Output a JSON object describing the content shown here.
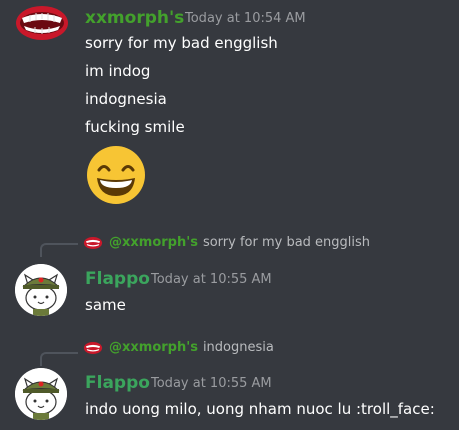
{
  "messages": [
    {
      "author": "xxmorph's",
      "timestamp": "Today at 10:54 AM",
      "lines": [
        "sorry for my bad engglish",
        "im indog",
        "indognesia",
        "fucking smile"
      ],
      "emoji": "grinning-smile"
    },
    {
      "reply": {
        "mention": "@xxmorph's",
        "text": "sorry for my bad engglish"
      },
      "author": "Flappo",
      "timestamp": "Today at 10:55 AM",
      "text": "same"
    },
    {
      "reply": {
        "mention": "@xxmorph's",
        "text": "indognesia"
      },
      "author": "Flappo",
      "timestamp": "Today at 10:55 AM",
      "text": "indo uong milo, uong nham nuoc lu :troll_face:"
    }
  ],
  "colors": {
    "background": "#36393f",
    "xxmorph_name": "#43a12c",
    "flappo_name": "#3ba55d",
    "timestamp": "#9a9ca0",
    "message_text": "#ffffff"
  },
  "icons": {
    "xxmorph_avatar": "teeth-mouth-icon",
    "flappo_avatar": "soldier-cat-icon",
    "emoji": "grinning-face-emoji"
  }
}
